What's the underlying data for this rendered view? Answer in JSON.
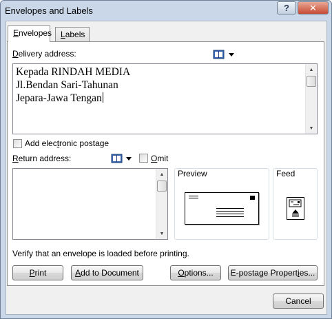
{
  "window": {
    "title": "Envelopes and Labels",
    "help_glyph": "?",
    "close_glyph": "✕"
  },
  "tabs": [
    {
      "label_first": "E",
      "label_rest": "nvelopes",
      "active": true
    },
    {
      "label_first": "L",
      "label_rest": "abels",
      "active": false
    }
  ],
  "delivery": {
    "label_first": "D",
    "label_rest": "elivery address:",
    "lines": [
      "Kepada RINDAH MEDIA",
      "Jl.Bendan Sari-Tahunan",
      "Jepara-Jawa Tengan"
    ]
  },
  "electronic_postage": {
    "label_pre": "Add elec",
    "label_mnem": "t",
    "label_post": "ronic postage",
    "checked": false
  },
  "return_address": {
    "label_first": "R",
    "label_rest": "eturn address:",
    "omit_pre": "O",
    "omit_rest": "mit",
    "omit_checked": false,
    "value": ""
  },
  "preview": {
    "label": "Preview"
  },
  "feed": {
    "label": "Feed"
  },
  "verify_text": "Verify that an envelope is loaded before printing.",
  "buttons": {
    "print": {
      "first": "P",
      "rest": "rint"
    },
    "add_to_document": {
      "pre": "",
      "mnem": "A",
      "post": "dd to Document"
    },
    "options": {
      "pre": "",
      "mnem": "O",
      "post": "ptions..."
    },
    "epostage": {
      "pre": "E-postage Propert",
      "mnem": "i",
      "post": "es..."
    },
    "cancel": "Cancel"
  },
  "icons": {
    "address_book": "address-book-icon",
    "dropdown": "dropdown-arrow-icon",
    "envelope_preview": "envelope-preview-icon",
    "feed": "envelope-feed-icon"
  },
  "colors": {
    "title_bar": "#c9d7e8",
    "close_button": "#c74b35",
    "dialog_bg": "#f0f0f0"
  }
}
